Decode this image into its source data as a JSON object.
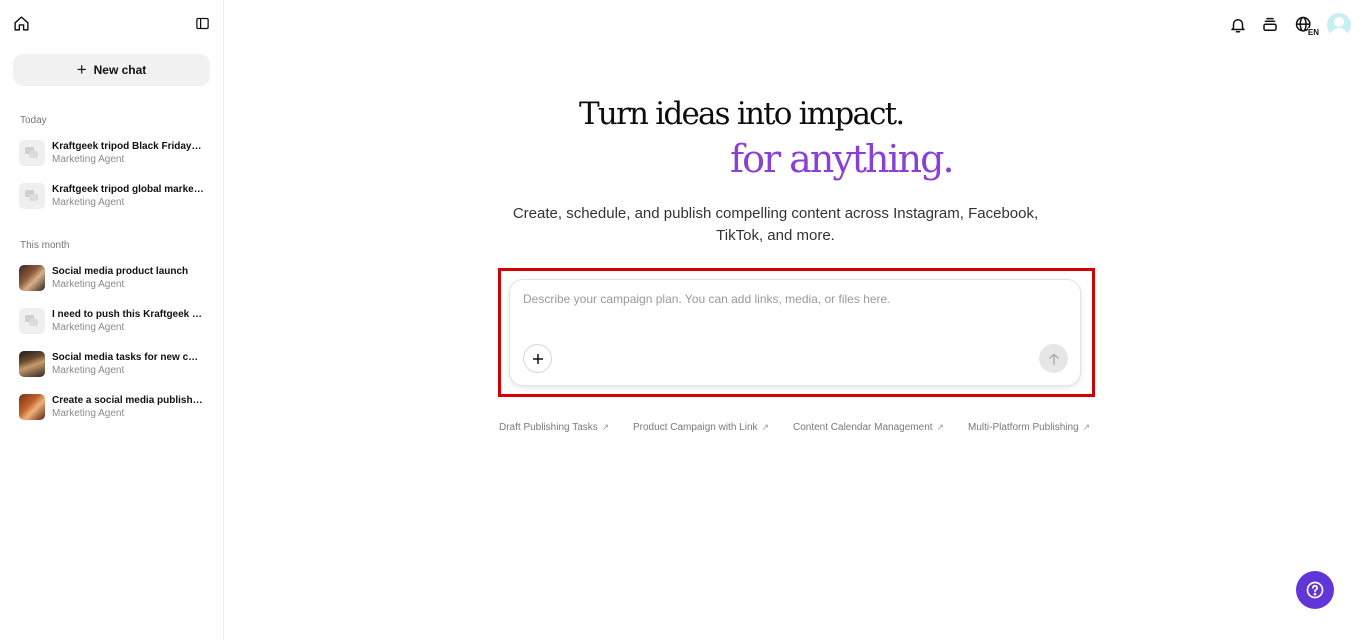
{
  "sidebar": {
    "new_chat_label": "New chat",
    "sections": [
      {
        "label": "Today",
        "items": [
          {
            "title": "Kraftgeek tripod Black Friday pr...",
            "subtitle": "Marketing Agent"
          },
          {
            "title": "Kraftgeek tripod global marketi...",
            "subtitle": "Marketing Agent"
          }
        ]
      },
      {
        "label": "This month",
        "items": [
          {
            "title": "Social media product launch",
            "subtitle": "Marketing Agent"
          },
          {
            "title": "I need to push this Kraftgeek se...",
            "subtitle": "Marketing Agent"
          },
          {
            "title": "Social media tasks for new coff...",
            "subtitle": "Marketing Agent"
          },
          {
            "title": "Create a social media publishin...",
            "subtitle": "Marketing Agent"
          }
        ]
      }
    ]
  },
  "header": {
    "language_code": "EN"
  },
  "hero": {
    "line1": "Turn ideas into impact.",
    "line2": "for anything.",
    "subtitle_line1": "Create, schedule, and publish compelling content across Instagram, Facebook,",
    "subtitle_line2": "TikTok, and more."
  },
  "composer": {
    "placeholder": "Describe your campaign plan. You can add links, media, or files here.",
    "value": ""
  },
  "suggestions": [
    {
      "label": "Draft Publishing Tasks",
      "arrow": "↗"
    },
    {
      "label": "Product Campaign with Link",
      "arrow": "↗"
    },
    {
      "label": "Content Calendar Management",
      "arrow": "↗"
    },
    {
      "label": "Multi-Platform Publishing",
      "arrow": "↗"
    }
  ],
  "colors": {
    "accent_purple": "#8a3fd6",
    "help_button": "#6136d9",
    "highlight_border": "#d40000"
  }
}
